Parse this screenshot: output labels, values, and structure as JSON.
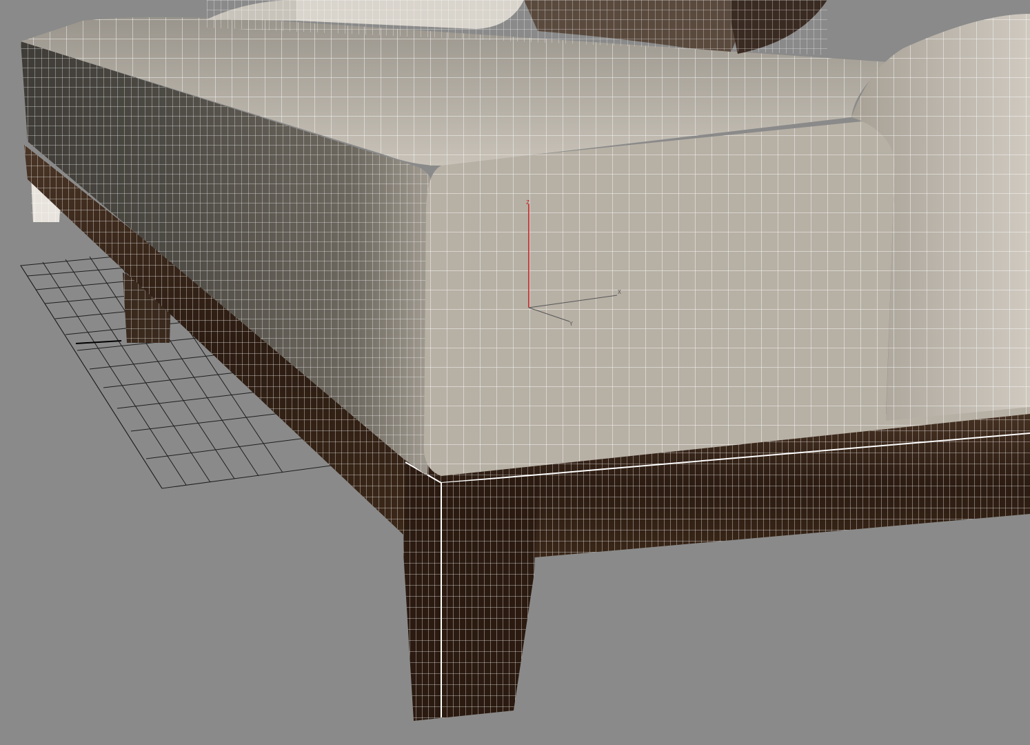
{
  "viewport": {
    "background": "#8a8a8a",
    "grid_color": "#1e1e1e",
    "wire_color": "#ffffff",
    "fabric_color": "#b8b1a6",
    "fabric_shadow": "#4a4640",
    "wood_color": "#2c1d14",
    "wood_light": "#5a3c28"
  },
  "gizmo": {
    "z_label": "Z",
    "x_label": "X",
    "y_label": "Y",
    "z_color": "#c41e1e",
    "x_color": "#555555",
    "y_color": "#555555"
  }
}
